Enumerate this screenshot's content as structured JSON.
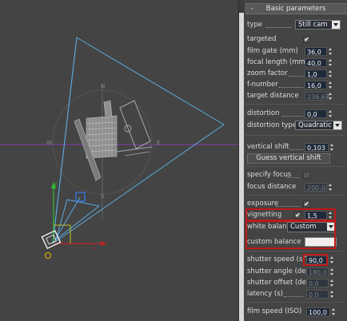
{
  "viewport": {
    "compass": {
      "n": "N",
      "e": "E",
      "w": "W",
      "s": "S"
    },
    "colors": {
      "background": "#444444",
      "frustum": "#5aa9dc",
      "horizon": "#8a3ab0",
      "axis_x": "#c02020",
      "axis_y": "#30c030"
    }
  },
  "panel": {
    "rollout_title": "Basic parameters",
    "rollout_toggle": "-",
    "type_label": "type",
    "type_value": "Still cam",
    "targeted_label": "targeted",
    "targeted_checked": "✔",
    "film_gate_label": "film gate (mm)",
    "film_gate_value": "36,0",
    "focal_length_label": "focal length (mm)",
    "focal_length_value": "40,0",
    "zoom_factor_label": "zoom factor",
    "zoom_factor_value": "1,0",
    "f_number_label": "f-number",
    "f_number_value": "16,0",
    "target_distance_label": "target distance",
    "target_distance_value": "236,67",
    "distortion_label": "distortion",
    "distortion_value": "0,0",
    "distortion_type_label": "distortion type",
    "distortion_type_value": "Quadratic",
    "vertical_shift_label": "vertical shift",
    "vertical_shift_value": "0,103",
    "guess_vertical_shift_button": "Guess vertical shift",
    "specify_focus_label": "specify focus",
    "focus_distance_label": "focus distance",
    "focus_distance_value": "200,0",
    "exposure_label": "exposure",
    "exposure_checked": "✔",
    "vignetting_label": "vignetting",
    "vignetting_checked": "✔",
    "vignetting_value": "1,5",
    "white_balance_label": "white balance",
    "white_balance_value": "Custom",
    "custom_balance_label": "custom balance",
    "custom_balance_color": "#f2efec",
    "shutter_speed_label": "shutter speed (s^-1)",
    "shutter_speed_value": "90,0",
    "shutter_angle_label": "shutter angle (deg)",
    "shutter_angle_value": "180,0",
    "shutter_offset_label": "shutter offset (deg)",
    "shutter_offset_value": "0,0",
    "latency_label": "latency (s)",
    "latency_value": "0,0",
    "film_speed_label": "film speed (ISO)",
    "film_speed_value": "100,0"
  }
}
